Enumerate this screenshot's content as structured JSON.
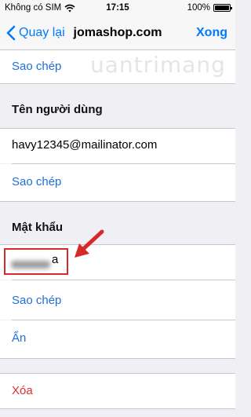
{
  "status_bar": {
    "carrier": "Không có SIM",
    "time": "17:15",
    "battery": "100%"
  },
  "nav": {
    "back_label": "Quay lại",
    "title": "jomashop.com",
    "done_label": "Xong"
  },
  "watermark": "uantrimang",
  "top_section": {
    "copy_label": "Sao chép"
  },
  "username_section": {
    "header": "Tên người dùng",
    "value": "havy12345@mailinator.com",
    "copy_label": "Sao chép"
  },
  "password_section": {
    "header": "Mật khẩu",
    "visible_suffix": "a",
    "copy_label": "Sao chép",
    "hide_label": "Ẩn"
  },
  "delete_label": "Xóa",
  "colors": {
    "link": "#1f6fd8",
    "destructive": "#e02b2b",
    "annotation": "#d62a2a"
  },
  "icons": [
    "wifi-icon",
    "battery-icon",
    "chevron-left-icon",
    "arrow-icon"
  ]
}
